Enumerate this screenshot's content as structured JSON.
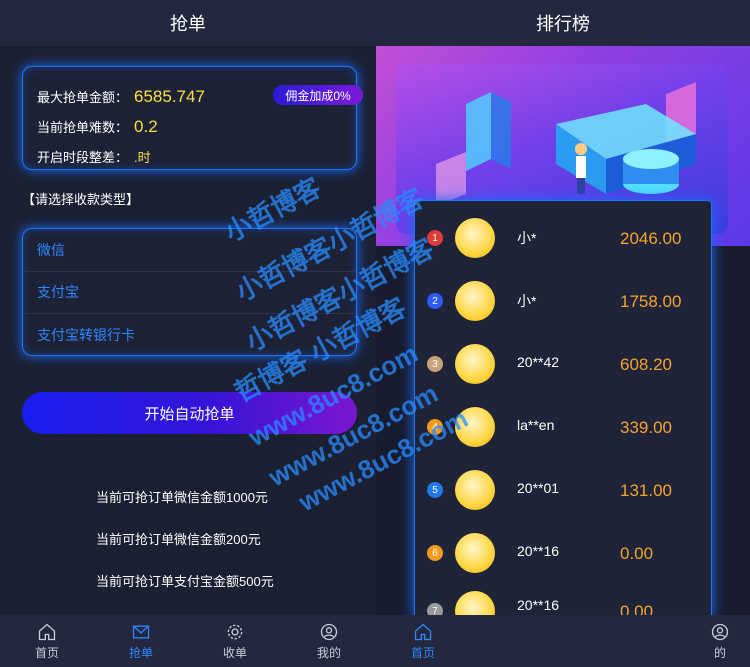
{
  "left": {
    "title": "抢单",
    "info": {
      "max_label": "最大抢单金额：",
      "max_value": "6585.747",
      "difficulty_label": "当前抢单难数：",
      "difficulty_value": "0.2",
      "period_label": "开启时段整差：",
      "period_value": ".时",
      "badge": "佣金加成0%"
    },
    "select_label": "【请选择收款类型】",
    "payment_types": [
      "微信",
      "支付宝",
      "支付宝转银行卡"
    ],
    "start_button": "开始自动抢单",
    "amount_lines": [
      "当前可抢订单微信金额1000元",
      "当前可抢订单微信金额200元",
      "当前可抢订单支付宝金额500元"
    ],
    "nav": [
      {
        "label": "首页",
        "icon": "home-icon",
        "active": false
      },
      {
        "label": "抢单",
        "icon": "mail-icon",
        "active": true
      },
      {
        "label": "收单",
        "icon": "gear-icon",
        "active": false
      },
      {
        "label": "我的",
        "icon": "user-icon",
        "active": false
      }
    ]
  },
  "right": {
    "title": "排行榜",
    "ranks": [
      {
        "rank": "1",
        "name": "小*",
        "amount": "2046.00",
        "color": "#e03b3b"
      },
      {
        "rank": "2",
        "name": "小*",
        "amount": "1758.00",
        "color": "#2e5bff"
      },
      {
        "rank": "3",
        "name": "20**42",
        "amount": "608.20",
        "color": "#c9a37a"
      },
      {
        "rank": "4",
        "name": "la**en",
        "amount": "339.00",
        "color": "#f29b1e"
      },
      {
        "rank": "5",
        "name": "20**01",
        "amount": "131.00",
        "color": "#1f7ae8"
      },
      {
        "rank": "6",
        "name": "20**16",
        "amount": "0.00",
        "color": "#f29b1e"
      },
      {
        "rank": "7",
        "name": "20**16",
        "amount": "0.00",
        "color": "#9a9a9a"
      }
    ],
    "nav": [
      {
        "label": "首页",
        "icon": "home-icon",
        "active": true
      },
      {
        "label": "的",
        "icon": "user-icon",
        "active": false
      }
    ]
  },
  "watermarks": [
    "小哲博客",
    "小哲博客小哲博客",
    "小哲博客小哲博客",
    "哲博客 小哲博客",
    "www.8uc8.com",
    "www.8uc8.com",
    "www.8uc8.com"
  ],
  "colors": {
    "accent": "#2d88ff",
    "gold": "#f5e042",
    "amount": "#f4a32e"
  }
}
